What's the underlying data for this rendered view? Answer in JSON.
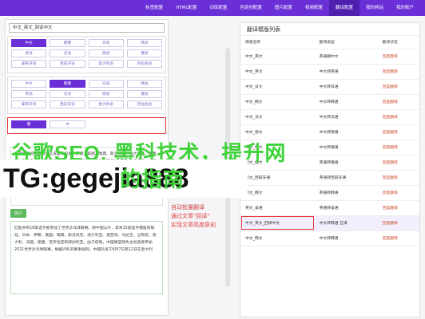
{
  "nav": [
    "标签配置",
    "HTML配置",
    "词库配置",
    "色原创配置",
    "图片配置",
    "视频配置",
    "翻译配置",
    "我的网站",
    "我的账户"
  ],
  "left": {
    "combo": "中文_英文_回译中文",
    "row1": [
      "中文",
      "繁體",
      "日语",
      "韩语",
      "英语",
      "法语",
      "德语",
      "俄语",
      "葡萄牙语",
      "西班牙语",
      "意大利语",
      "阿拉伯语"
    ],
    "row2": [
      "中文",
      "繁體",
      "日语",
      "韩语",
      "英语",
      "法语",
      "德语",
      "俄语",
      "葡萄牙语",
      "西班牙语",
      "意大利语",
      "阿拉伯语"
    ],
    "row3": [
      "繁",
      "中"
    ],
    "text1": "，英格兰的回顾也可以说是，日本：伊朗、美国、瑞典、斯洛伐克、澳大利亚、墨西哥、乌拉圭、立陶宛、意大利、法国、德国、克罗地亚和保加利亚。由于疫情，中国男篮错失主动选择参加2021年当今世界乒乓球联赛。你能在以色列、中国(6月7日",
    "run": "执行",
    "text2": "匹能共有16家选手部参加了世界乒乓球联赛。除中国以外，其余15家选手都是阿根廷、日本、伊朗、美国、瑞典、斯洛伐克、澳大利亚、墨西哥、乌拉圭、立陶宛、意大利、法国、德国、克罗地亚和保加利亚。由于疫情，中国男篮错失主动选择参加2021世界乒乓球联赛。根据VNL的赛事规则，中国队将于6月7日至12日在意大利"
  },
  "right": {
    "title": "翻译模版列表",
    "headers": [
      "模版名称",
      "翻译类型",
      "翻译状态"
    ],
    "rows": [
      [
        "中文_英文",
        "英语翻中文",
        "百度翻译"
      ],
      [
        "中文_英文",
        "中文转英语",
        "百度翻译"
      ],
      [
        "中文_日文",
        "中文转日语",
        "百度翻译"
      ],
      [
        "中文_韩文",
        "中文转韩语",
        "百度翻译"
      ],
      [
        "中文_法文",
        "中文转法语",
        "百度翻译"
      ],
      [
        "中文_德文",
        "中文转德语",
        "百度翻译"
      ],
      [
        "中文_俄文",
        "中文转俄语",
        "百度翻译"
      ],
      [
        "英文_俄文",
        "英语转俄语",
        "百度翻译"
      ],
      [
        "英文_西班牙语",
        "英语转西班牙语",
        "百度翻译"
      ],
      [
        "英文_韩文",
        "英语转韩语",
        "百度翻译"
      ],
      [
        "英文_泰语",
        "英语转泰语",
        "百度翻译"
      ],
      [
        "中文_英文_回译中文",
        "中文转韩语 互译",
        "百度翻译"
      ],
      [
        "中文_韩文",
        "中文转韩语",
        "百度翻译"
      ]
    ]
  },
  "promo": [
    "自动批量翻译",
    "通过文章\"回译\"",
    "实现文章高度原创"
  ],
  "overlay": {
    "h1": "谷歌SEO, 黑科技术，提升网",
    "h2": "的指南",
    "tg": "TG:gegejia888"
  }
}
